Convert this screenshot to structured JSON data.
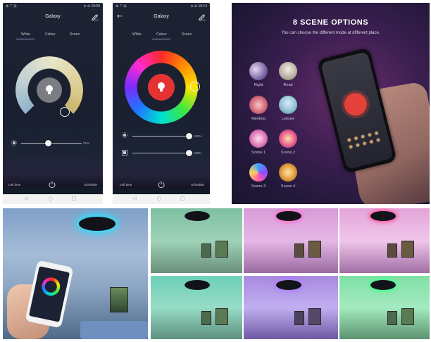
{
  "phone1": {
    "status_left": "⊕ ⊤ ⊟",
    "status_right": "⊙ ⊘ 10:00",
    "title": "Galaxy",
    "tabs": [
      "White",
      "Colour",
      "Scene"
    ],
    "active_tab": "White",
    "brightness_percent": "31%",
    "bottom_left": "Left time",
    "bottom_right": "Schedule",
    "accent": "#d9c98b"
  },
  "phone2": {
    "status_left": "⊕ ⊤ ⊟",
    "status_right": "⊙ ⊘ 10:14",
    "title": "Galaxy",
    "tabs": [
      "White",
      "Colour",
      "Scene"
    ],
    "active_tab": "Colour",
    "brightness_percent": "100%",
    "saturation_percent": "100%",
    "bottom_left": "Left time",
    "bottom_right": "Schedule",
    "accent": "#e53333"
  },
  "scene_panel": {
    "title_number": "8",
    "title": "SCENE OPTIONS",
    "subtitle": "You can choose  the different mode at different place.",
    "scenes": [
      "Night",
      "Read",
      "Meeting",
      "Leisure",
      "Scene 1",
      "Scene 2",
      "Scene 3",
      "Scene 4"
    ]
  },
  "icons": {
    "back": "arrow-left-icon",
    "edit": "pencil-icon",
    "bulb": "lightbulb-icon",
    "power": "power-icon",
    "home": "home-icon"
  }
}
